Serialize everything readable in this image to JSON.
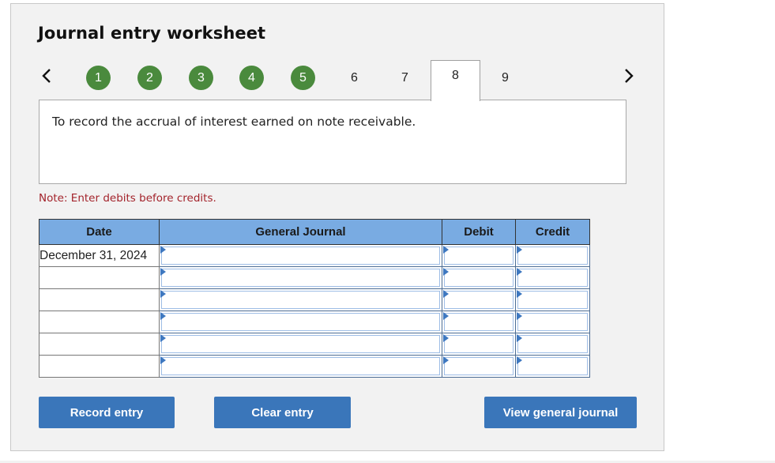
{
  "title": "Journal entry worksheet",
  "nav": {
    "prev_icon": "chevron-left-icon",
    "next_icon": "chevron-right-icon",
    "steps": [
      {
        "label": "1",
        "state": "completed"
      },
      {
        "label": "2",
        "state": "completed"
      },
      {
        "label": "3",
        "state": "completed"
      },
      {
        "label": "4",
        "state": "completed"
      },
      {
        "label": "5",
        "state": "completed"
      },
      {
        "label": "6",
        "state": "pending"
      },
      {
        "label": "7",
        "state": "pending"
      },
      {
        "label": "8",
        "state": "active"
      },
      {
        "label": "9",
        "state": "pending"
      }
    ],
    "completed_color": "#4a8a3d"
  },
  "description": "To record the accrual of interest earned on note receivable.",
  "note": "Note: Enter debits before credits.",
  "table": {
    "headers": [
      "Date",
      "General Journal",
      "Debit",
      "Credit"
    ],
    "header_color": "#79abe2",
    "rows": [
      {
        "date": "December 31, 2024",
        "account": "",
        "debit": "",
        "credit": ""
      },
      {
        "date": "",
        "account": "",
        "debit": "",
        "credit": ""
      },
      {
        "date": "",
        "account": "",
        "debit": "",
        "credit": ""
      },
      {
        "date": "",
        "account": "",
        "debit": "",
        "credit": ""
      },
      {
        "date": "",
        "account": "",
        "debit": "",
        "credit": ""
      },
      {
        "date": "",
        "account": "",
        "debit": "",
        "credit": ""
      }
    ]
  },
  "buttons": {
    "record": "Record entry",
    "clear": "Clear entry",
    "view": "View general journal",
    "color": "#3a76ba"
  }
}
